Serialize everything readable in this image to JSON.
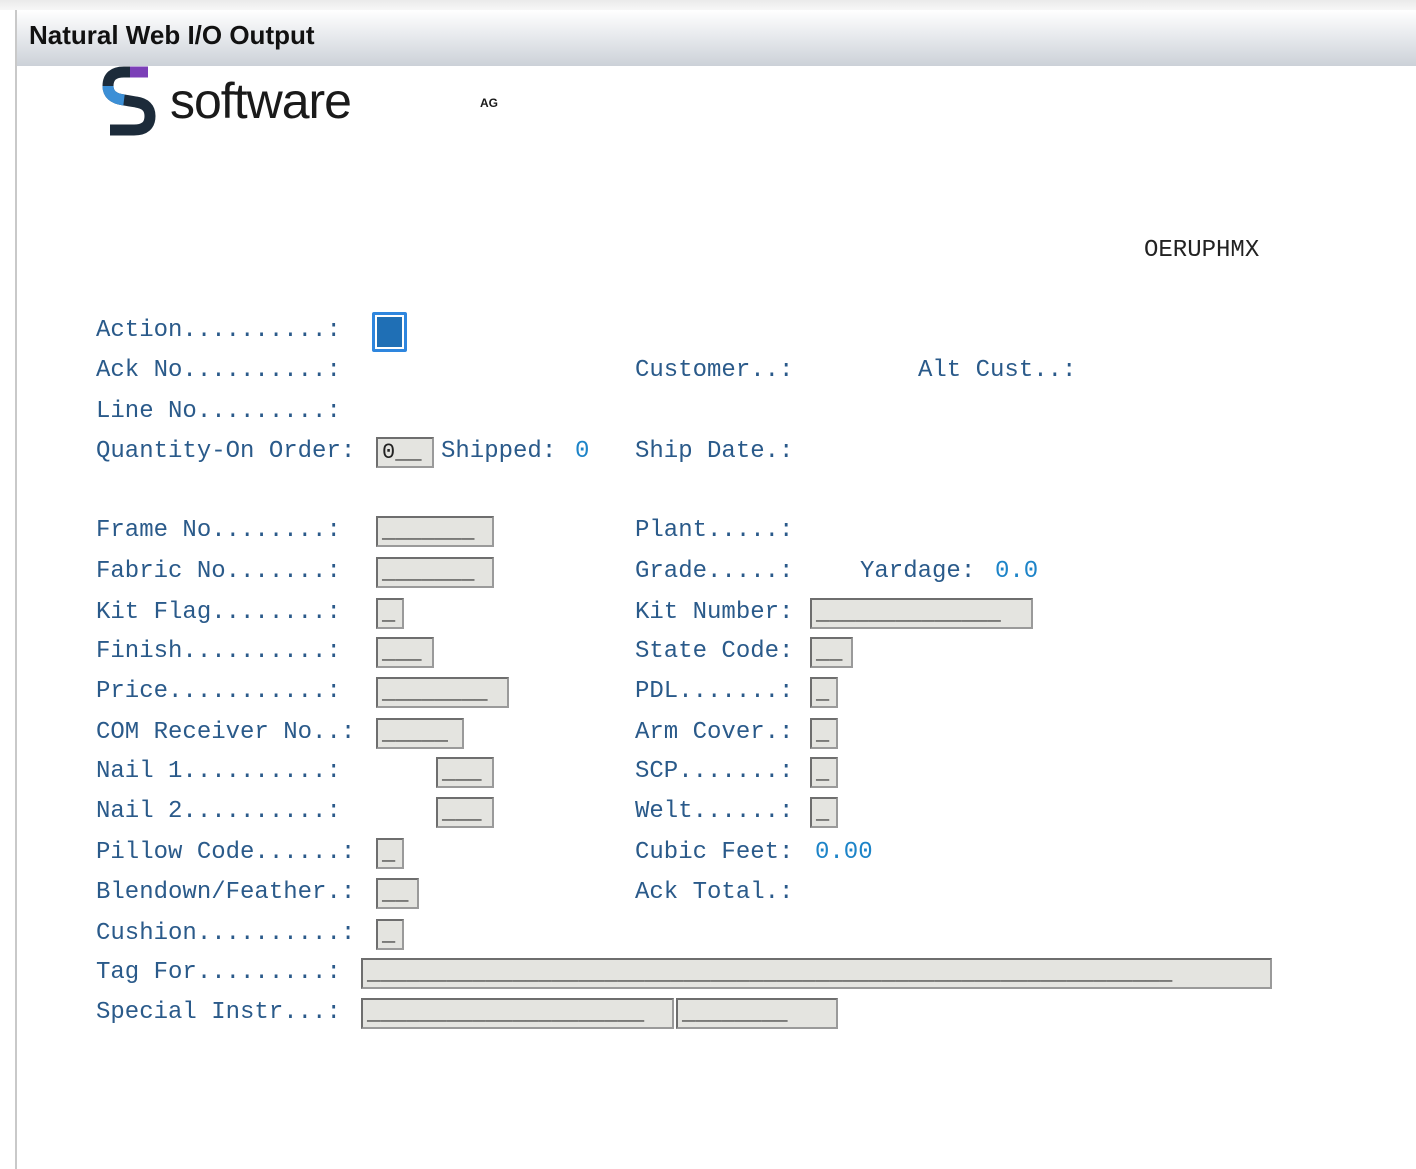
{
  "window": {
    "title": "Natural Web I/O Output"
  },
  "logo": {
    "word": "software",
    "suffix": "AG"
  },
  "program_id": "OERUPHMX",
  "labels": {
    "action": "Action..........:",
    "ack_no": "Ack No..........:",
    "line_no": "Line No.........:",
    "qty_on_order": "Quantity-On Order:",
    "shipped": "Shipped:",
    "customer": "Customer..:",
    "alt_cust": "Alt Cust..:",
    "ship_date": "Ship Date.:",
    "frame_no": "Frame No........:",
    "fabric_no": "Fabric No.......:",
    "kit_flag": "Kit Flag........:",
    "finish": "Finish..........:",
    "price": "Price...........:",
    "com_receiver": "COM Receiver No..:",
    "nail1": "Nail 1..........:",
    "nail2": "Nail 2..........:",
    "pillow_code": "Pillow Code......:",
    "blendown": "Blendown/Feather.:",
    "cushion": "Cushion..........:",
    "tag_for": "Tag For.........:",
    "special_instr": "Special Instr...:",
    "plant": "Plant.....:",
    "grade": "Grade.....:",
    "yardage": "Yardage:",
    "kit_number": "Kit Number:",
    "state_code": "State Code:",
    "pdl": "PDL.......:",
    "arm_cover": "Arm Cover.:",
    "scp": "SCP.......:",
    "welt": "Welt......:",
    "cubic_feet": "Cubic Feet:",
    "ack_total": "Ack Total.:"
  },
  "values": {
    "shipped": "0",
    "yardage": "0.0",
    "cubic_feet": "0.00"
  },
  "fields": {
    "qty_on_order": "0__",
    "frame_no": "_______",
    "fabric_no": "_______",
    "kit_flag": "_",
    "finish": "___",
    "price": "________",
    "com_receiver": "_____",
    "nail1": "___",
    "nail2": "___",
    "pillow_code": "_",
    "blendown": "__",
    "cushion": "_",
    "tag_for": "_____________________________________________________________",
    "special_instr_1": "_____________________",
    "special_instr_2": "________",
    "kit_number": "______________",
    "state_code": "__",
    "pdl": "_",
    "arm_cover": "_",
    "scp": "_",
    "welt": "_"
  }
}
